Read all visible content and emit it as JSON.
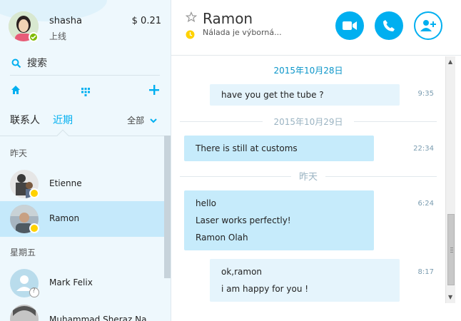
{
  "user": {
    "name": "shasha",
    "status": "上线",
    "credit": "$ 0.21"
  },
  "search": {
    "label": "搜索"
  },
  "tabs": {
    "contacts": "联系人",
    "recent": "近期",
    "filter": "全部"
  },
  "sections": {
    "yesterday": "昨天",
    "friday": "星期五"
  },
  "contacts": [
    {
      "name": "Etienne"
    },
    {
      "name": "Ramon"
    },
    {
      "name": "Mark Felix"
    },
    {
      "name": "Muhammad Sheraz Na"
    }
  ],
  "chat": {
    "title": "Ramon",
    "mood": "Nálada je výborná..."
  },
  "messages": {
    "d1": "2015年10月28日",
    "m1": {
      "lines": [
        "have you get the tube ?"
      ],
      "time": "9:35"
    },
    "d2": "2015年10月29日",
    "m2": {
      "lines": [
        "There is still at customs"
      ],
      "time": "22:34"
    },
    "d3": "昨天",
    "m3": {
      "lines": [
        "hello",
        "Laser works perfectly!",
        "Ramon Olah"
      ],
      "time": "6:24"
    },
    "m4": {
      "lines": [
        "ok,ramon",
        "i am happy for you !"
      ],
      "time": "8:17"
    }
  },
  "colors": {
    "accent": "#00aff0",
    "presence_online": "#7fba00",
    "presence_away": "#ffd200"
  }
}
